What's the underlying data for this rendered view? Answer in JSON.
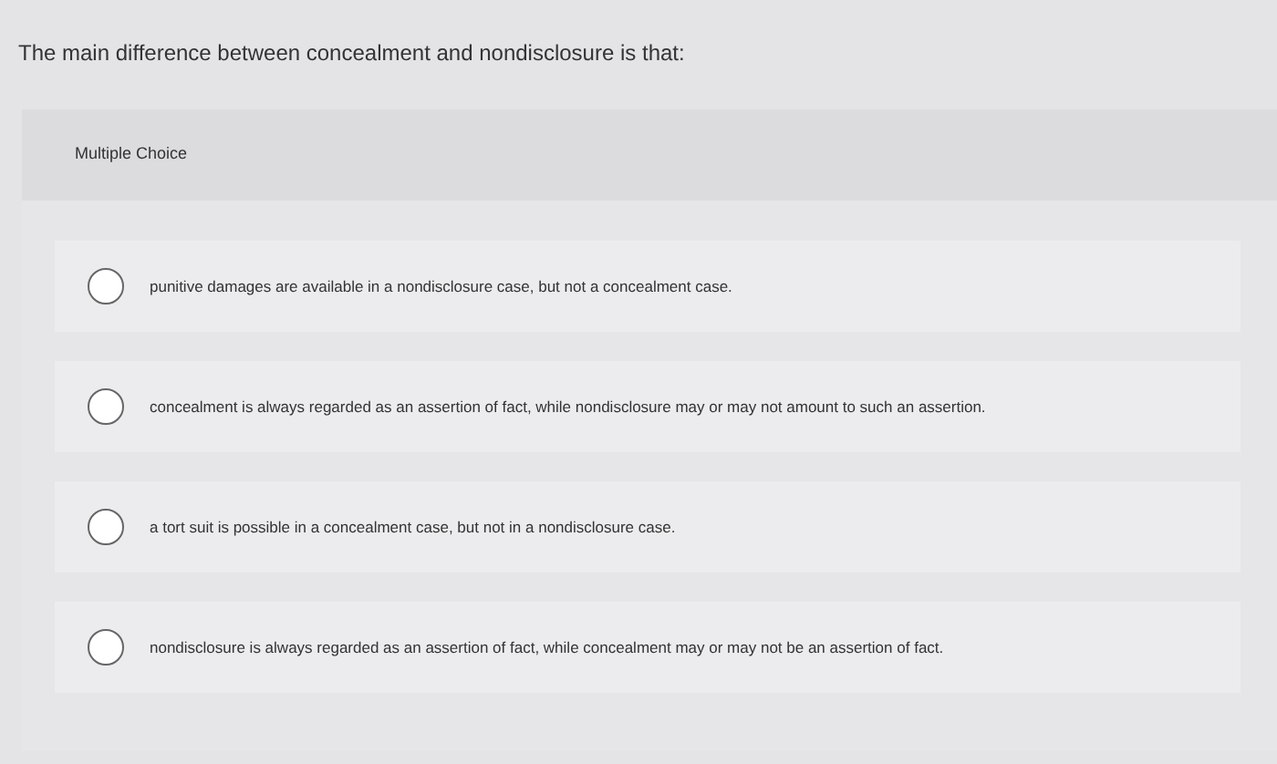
{
  "question": "The main difference between concealment and nondisclosure is that:",
  "question_type": "Multiple Choice",
  "options": [
    {
      "label": "punitive damages are available in a nondisclosure case, but not a concealment case.",
      "selected": false
    },
    {
      "label": "concealment is always regarded as an assertion of fact, while nondisclosure may or may not amount to such an assertion.",
      "selected": false
    },
    {
      "label": "a tort suit is possible in a concealment case, but not in a nondisclosure case.",
      "selected": false
    },
    {
      "label": "nondisclosure is always regarded as an assertion of fact, while concealment may or may not be an assertion of fact.",
      "selected": false
    }
  ]
}
